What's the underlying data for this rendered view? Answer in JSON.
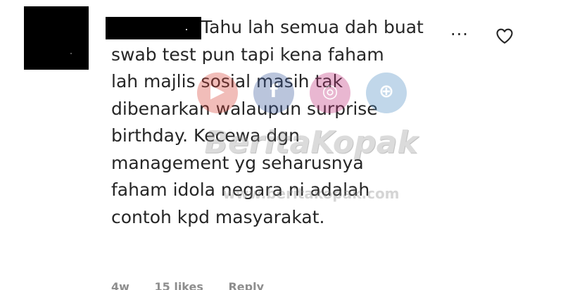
{
  "comment": {
    "lines": [
      "Tahu lah semua dah buat",
      "swab test pun tapi kena faham",
      "lah majlis sosial masih tak",
      "dibenarkan walaupun surprise",
      "birthday. Kecewa dgn",
      "management yg seharusnya",
      "faham idola negara ni adalah",
      "contoh kpd masyarakat."
    ]
  },
  "actions": {
    "more_icon": "more-options-icon",
    "more_glyph": "...",
    "like_icon": "heart-icon"
  },
  "watermark": {
    "title": "BeritaKopak",
    "url": "www.beritakopak.com",
    "icons": [
      "youtube-icon",
      "facebook-icon",
      "instagram-icon",
      "globe-icon"
    ],
    "colors": {
      "youtube": "#d8443a",
      "facebook": "#3b5c9e",
      "instagram": "#c1357e",
      "globe": "#4f8fc4"
    }
  },
  "meta": {
    "time": "4w",
    "likes": "15 likes",
    "reply": "Reply"
  },
  "colors": {
    "text": "#262626",
    "muted": "#8e8e8e",
    "redaction": "#000000"
  }
}
